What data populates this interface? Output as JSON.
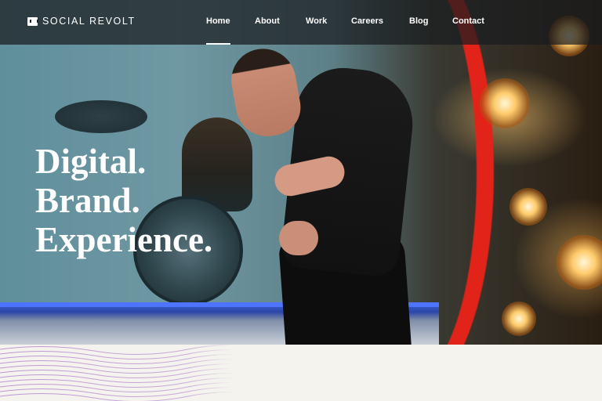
{
  "brand": {
    "name": "SOCIAL REVOLT",
    "logo_icon": "sr-logo-icon"
  },
  "nav": {
    "items": [
      {
        "label": "Home",
        "active": true
      },
      {
        "label": "About",
        "active": false
      },
      {
        "label": "Work",
        "active": false
      },
      {
        "label": "Careers",
        "active": false
      },
      {
        "label": "Blog",
        "active": false
      },
      {
        "label": "Contact",
        "active": false
      }
    ]
  },
  "hero": {
    "lines": [
      "Digital.",
      "Brand.",
      "Experience."
    ]
  },
  "colors": {
    "accent_red": "#e2231a",
    "stage_blue": "#3a5fd0",
    "wave_purple": "#b58bd0",
    "page_bg": "#f5f3ee"
  }
}
